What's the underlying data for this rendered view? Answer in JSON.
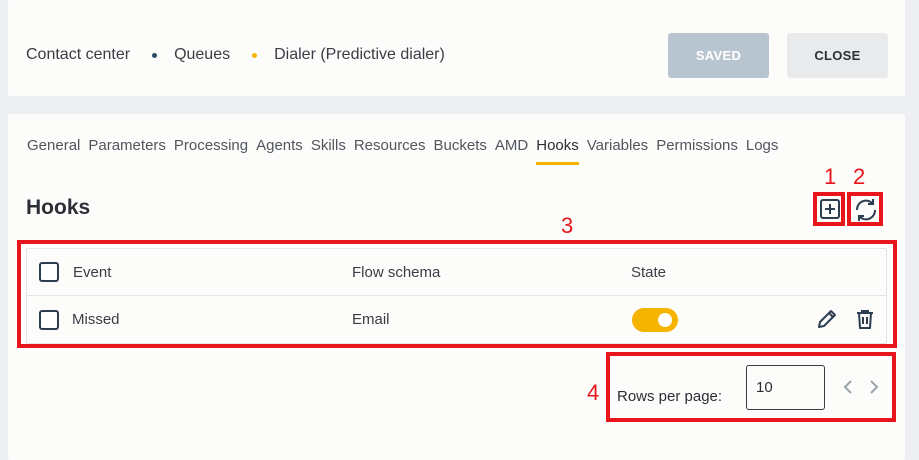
{
  "breadcrumb": {
    "items": [
      "Contact center",
      "Queues",
      "Dialer (Predictive dialer)"
    ]
  },
  "header": {
    "saved_label": "SAVED",
    "close_label": "CLOSE"
  },
  "tabs": [
    "General",
    "Parameters",
    "Processing",
    "Agents",
    "Skills",
    "Resources",
    "Buckets",
    "AMD",
    "Hooks",
    "Variables",
    "Permissions",
    "Logs"
  ],
  "active_tab": "Hooks",
  "section": {
    "title": "Hooks"
  },
  "table": {
    "headers": {
      "event": "Event",
      "flow": "Flow schema",
      "state": "State"
    },
    "rows": [
      {
        "event": "Missed",
        "flow": "Email",
        "state_on": true
      }
    ]
  },
  "pagination": {
    "label": "Rows per page:",
    "value": "10"
  },
  "annotations": {
    "a1": "1",
    "a2": "2",
    "a3": "3",
    "a4": "4"
  },
  "colors": {
    "accent": "#f5b400",
    "annotation": "#e8161c",
    "saved_bg": "#b8c5d0"
  },
  "icons": {
    "add": "plus-square-icon",
    "refresh": "refresh-icon",
    "edit": "pencil-icon",
    "delete": "trash-icon",
    "prev": "chevron-left-icon",
    "next": "chevron-right-icon"
  }
}
